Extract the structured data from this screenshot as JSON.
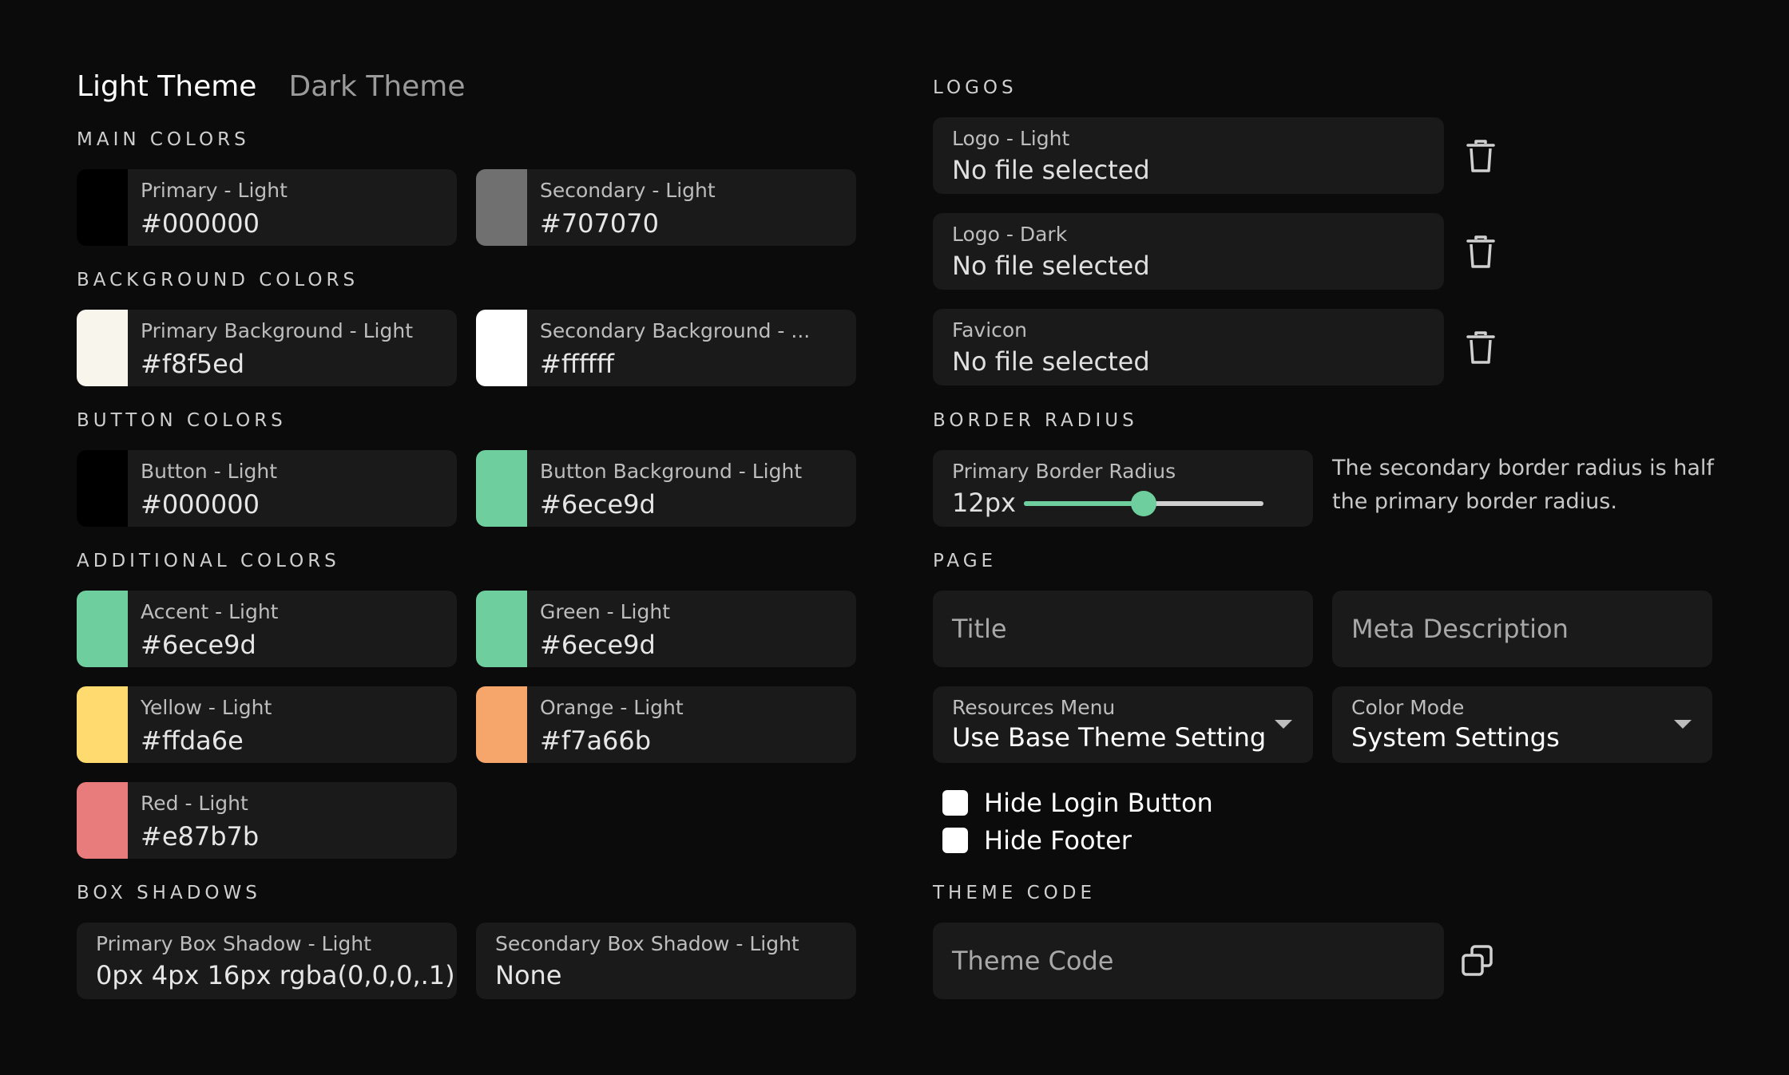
{
  "tabs": [
    {
      "label": "Light Theme",
      "active": true
    },
    {
      "label": "Dark Theme",
      "active": false
    }
  ],
  "sections": {
    "main_colors": "MAIN COLORS",
    "background_colors": "BACKGROUND COLORS",
    "button_colors": "BUTTON COLORS",
    "additional_colors": "ADDITIONAL COLORS",
    "box_shadows": "BOX SHADOWS",
    "logos": "LOGOS",
    "border_radius": "BORDER RADIUS",
    "page": "PAGE",
    "theme_code": "THEME CODE"
  },
  "colors": {
    "primary": {
      "label": "Primary - Light",
      "value": "#000000",
      "swatch": "#000000"
    },
    "secondary": {
      "label": "Secondary - Light",
      "value": "#707070",
      "swatch": "#707070"
    },
    "primary_bg": {
      "label": "Primary Background - Light",
      "value": "#f8f5ed",
      "swatch": "#f8f5ed"
    },
    "secondary_bg": {
      "label": "Secondary Background - ...",
      "value": "#ffffff",
      "swatch": "#ffffff"
    },
    "button": {
      "label": "Button - Light",
      "value": "#000000",
      "swatch": "#000000"
    },
    "button_bg": {
      "label": "Button Background - Light",
      "value": "#6ece9d",
      "swatch": "#6ece9d"
    },
    "accent": {
      "label": "Accent - Light",
      "value": "#6ece9d",
      "swatch": "#6ece9d"
    },
    "green": {
      "label": "Green - Light",
      "value": "#6ece9d",
      "swatch": "#6ece9d"
    },
    "yellow": {
      "label": "Yellow - Light",
      "value": "#ffda6e",
      "swatch": "#ffda6e"
    },
    "orange": {
      "label": "Orange - Light",
      "value": "#f7a66b",
      "swatch": "#f7a66b"
    },
    "red": {
      "label": "Red - Light",
      "value": "#e87b7b",
      "swatch": "#e87b7b"
    }
  },
  "shadows": {
    "primary": {
      "label": "Primary Box Shadow - Light",
      "value": "0px 4px 16px rgba(0,0,0,.1)"
    },
    "secondary": {
      "label": "Secondary Box Shadow - Light",
      "value": "None"
    }
  },
  "logos": [
    {
      "label": "Logo - Light",
      "value": "No file selected"
    },
    {
      "label": "Logo - Dark",
      "value": "No file selected"
    },
    {
      "label": "Favicon",
      "value": "No file selected"
    }
  ],
  "border_radius": {
    "label": "Primary Border Radius",
    "value": "12px",
    "slider_fraction": 0.5,
    "note": "The secondary border radius is half the primary border radius."
  },
  "page": {
    "title_placeholder": "Title",
    "meta_placeholder": "Meta Description",
    "resources_menu": {
      "label": "Resources Menu",
      "value": "Use Base Theme Setting"
    },
    "color_mode": {
      "label": "Color Mode",
      "value": "System Settings"
    },
    "hide_login": "Hide Login Button",
    "hide_footer": "Hide Footer"
  },
  "theme_code": {
    "placeholder": "Theme Code"
  },
  "icons": {
    "trash": "trash-icon",
    "copy": "copy-icon"
  },
  "accent_color": "#6ece9d"
}
